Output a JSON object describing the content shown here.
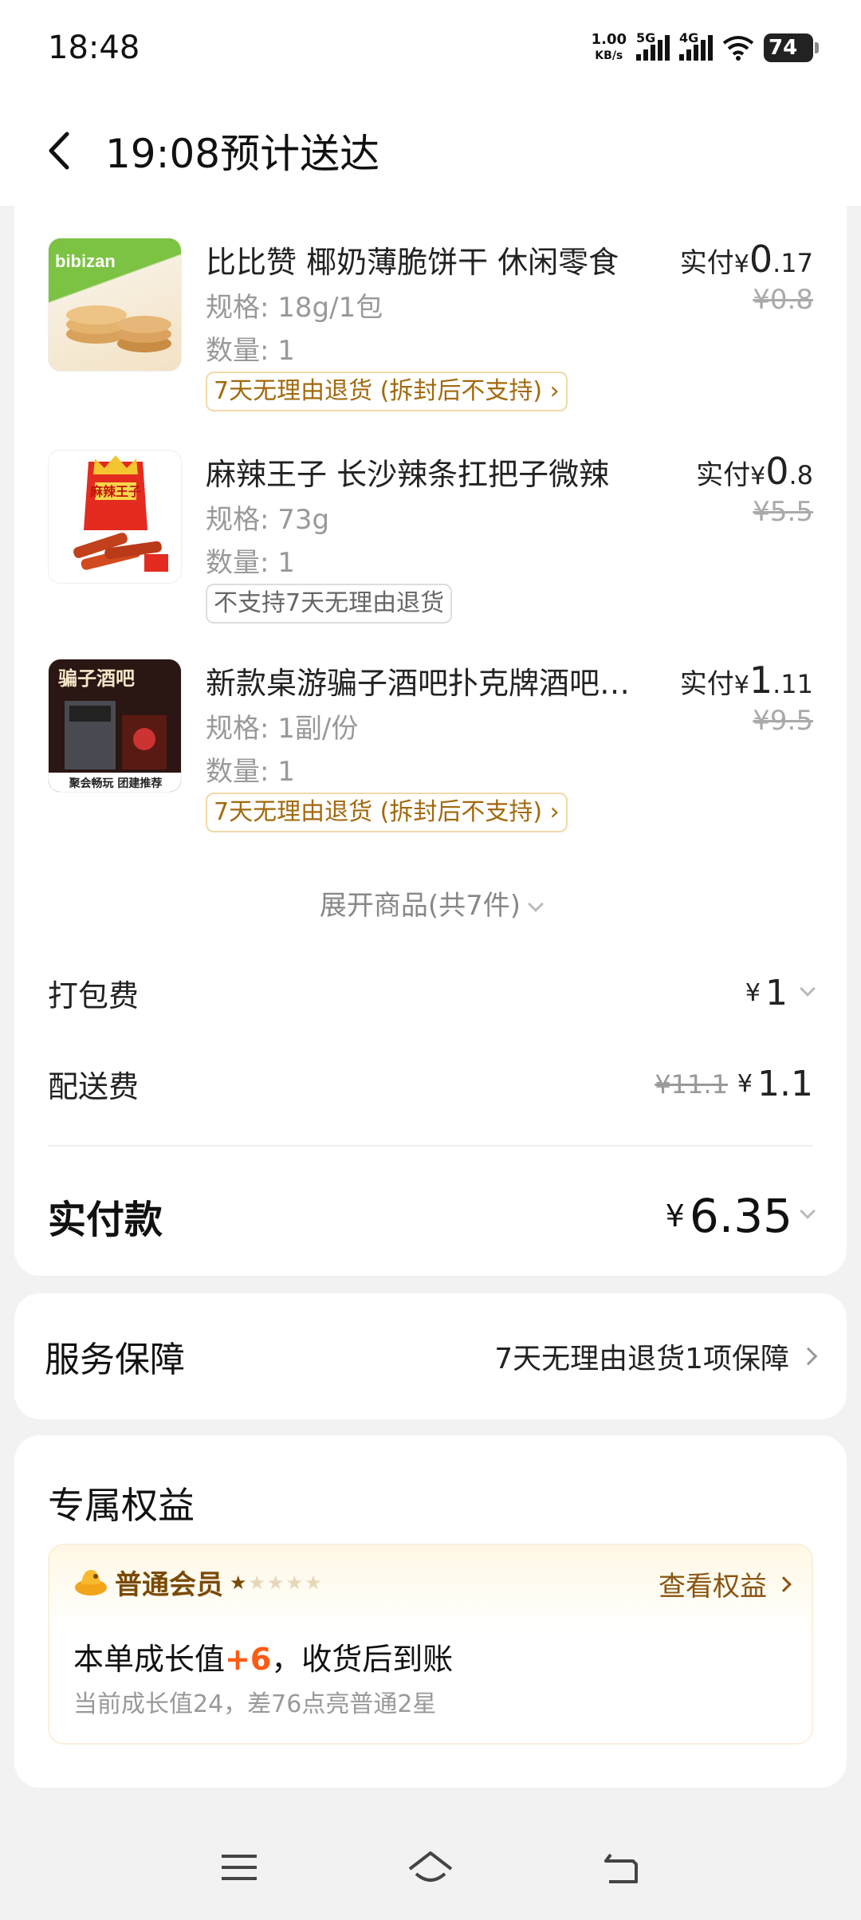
{
  "status_bar": {
    "time": "18:48",
    "net_speed_top": "1.00",
    "net_speed_bottom": "KB/s",
    "signal1": "5G",
    "signal2": "4G",
    "battery": "74"
  },
  "header": {
    "title": "19:08预计送达"
  },
  "items": [
    {
      "name": "比比赞 椰奶薄脆饼干 休闲零食",
      "spec": "规格: 18g/1包",
      "qty": "数量: 1",
      "tag": "7天无理由退货 (拆封后不支持) ›",
      "paid_label": "实付",
      "yen": "¥",
      "paid_int": "0",
      "paid_dec": ".17",
      "orig": "¥0.8"
    },
    {
      "name": "麻辣王子 长沙辣条扛把子微辣",
      "spec": "规格: 73g",
      "qty": "数量: 1",
      "tag": "不支持7天无理由退货",
      "paid_label": "实付",
      "yen": "¥",
      "paid_int": "0",
      "paid_dec": ".8",
      "orig": "¥5.5"
    },
    {
      "name": "新款桌游骗子酒吧扑克牌酒吧游戏",
      "spec": "规格: 1副/份",
      "qty": "数量: 1",
      "tag": "7天无理由退货 (拆封后不支持) ›",
      "paid_label": "实付",
      "yen": "¥",
      "paid_int": "1",
      "paid_dec": ".11",
      "orig": "¥9.5"
    }
  ],
  "thumb_text": {
    "item1": "bibizan",
    "item2": "麻辣王子",
    "item3_top": "骗子酒吧",
    "item3_bottom": "聚会畅玩 团建推荐"
  },
  "expand": {
    "label": "展开商品(共7件)"
  },
  "fees": {
    "packing_label": "打包费",
    "packing_yen": "¥",
    "packing_value": "1",
    "delivery_label": "配送费",
    "delivery_orig": "¥11.1",
    "delivery_yen": "¥",
    "delivery_value": "1.1"
  },
  "total": {
    "label": "实付款",
    "yen": "¥",
    "value": "6.35"
  },
  "service": {
    "label": "服务保障",
    "value": "7天无理由退货1项保障"
  },
  "perks": {
    "title": "专属权益",
    "member_level": "普通会员",
    "stars_on": "★",
    "stars_off": "★★★★",
    "view": "查看权益",
    "growth_prefix": "本单成长值",
    "growth_plus": "+6",
    "growth_suffix": "，收货后到账",
    "growth_sub": "当前成长值24，差76点亮普通2星"
  },
  "colors": {
    "accent": "#ff5a14",
    "gold": "#a2690d",
    "brown": "#7a4a07"
  }
}
